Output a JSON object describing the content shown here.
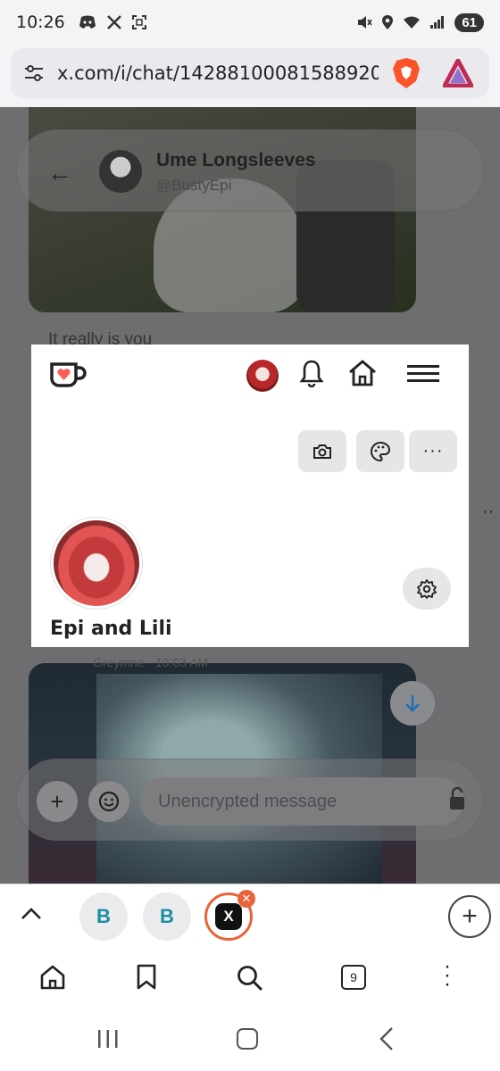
{
  "status_bar": {
    "time": "10:26",
    "battery": "61"
  },
  "browser": {
    "url": "x.com/i/chat/14288100081588920",
    "open_tabs_count": "9"
  },
  "background_chat": {
    "contact_name": "Ume Longsleeves",
    "contact_handle": "@BustyEpi",
    "message_text": "It really is you",
    "sender_line": "Greymne · 10:03 AM",
    "compose_placeholder": "Unencrypted message"
  },
  "kofi_card": {
    "profile_name": "Epi and Lili",
    "more_label": "···"
  },
  "tab_strip": {
    "tab1_label": "B",
    "tab2_label": "B",
    "tab3_label": "X"
  },
  "colors": {
    "kofi_accent": "#ff5e5b",
    "brave_orange": "#fb542b",
    "active_tab_ring": "#e8643a",
    "scroll_arrow": "#1d6fb5"
  }
}
